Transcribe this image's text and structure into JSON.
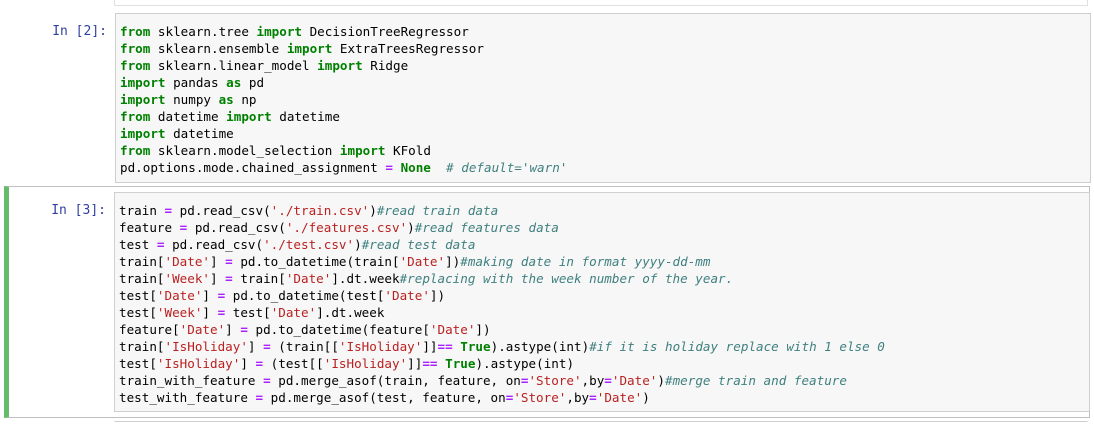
{
  "cells": [
    {
      "prompt": "In [2]:",
      "lines": [
        [
          {
            "t": "from",
            "c": "kw"
          },
          {
            "t": " sklearn.tree ",
            "c": ""
          },
          {
            "t": "import",
            "c": "kw"
          },
          {
            "t": " DecisionTreeRegressor",
            "c": ""
          }
        ],
        [
          {
            "t": "from",
            "c": "kw"
          },
          {
            "t": " sklearn.ensemble ",
            "c": ""
          },
          {
            "t": "import",
            "c": "kw"
          },
          {
            "t": " ExtraTreesRegressor",
            "c": ""
          }
        ],
        [
          {
            "t": "from",
            "c": "kw"
          },
          {
            "t": " sklearn.linear_model ",
            "c": ""
          },
          {
            "t": "import",
            "c": "kw"
          },
          {
            "t": " Ridge",
            "c": ""
          }
        ],
        [
          {
            "t": "import",
            "c": "kw"
          },
          {
            "t": " pandas ",
            "c": ""
          },
          {
            "t": "as",
            "c": "kw"
          },
          {
            "t": " pd",
            "c": ""
          }
        ],
        [
          {
            "t": "import",
            "c": "kw"
          },
          {
            "t": " numpy ",
            "c": ""
          },
          {
            "t": "as",
            "c": "kw"
          },
          {
            "t": " np",
            "c": ""
          }
        ],
        [
          {
            "t": "from",
            "c": "kw"
          },
          {
            "t": " datetime ",
            "c": ""
          },
          {
            "t": "import",
            "c": "kw"
          },
          {
            "t": " datetime",
            "c": ""
          }
        ],
        [
          {
            "t": "import",
            "c": "kw"
          },
          {
            "t": " datetime",
            "c": ""
          }
        ],
        [
          {
            "t": "from",
            "c": "kw"
          },
          {
            "t": " sklearn.model_selection ",
            "c": ""
          },
          {
            "t": "import",
            "c": "kw"
          },
          {
            "t": " KFold",
            "c": ""
          }
        ],
        [
          {
            "t": "pd.options.mode.chained_assignment ",
            "c": ""
          },
          {
            "t": "=",
            "c": "op"
          },
          {
            "t": " ",
            "c": ""
          },
          {
            "t": "None",
            "c": "kw"
          },
          {
            "t": "  # default='warn'",
            "c": "cmt"
          }
        ]
      ]
    },
    {
      "prompt": "In [3]:",
      "lines": [
        [
          {
            "t": "train ",
            "c": ""
          },
          {
            "t": "=",
            "c": "op"
          },
          {
            "t": " pd.read_csv(",
            "c": ""
          },
          {
            "t": "'./train.csv'",
            "c": "str"
          },
          {
            "t": ")",
            "c": ""
          },
          {
            "t": "#read train data",
            "c": "cmt"
          }
        ],
        [
          {
            "t": "feature ",
            "c": ""
          },
          {
            "t": "=",
            "c": "op"
          },
          {
            "t": " pd.read_csv(",
            "c": ""
          },
          {
            "t": "'./features.csv'",
            "c": "str"
          },
          {
            "t": ")",
            "c": ""
          },
          {
            "t": "#read features data",
            "c": "cmt"
          }
        ],
        [
          {
            "t": "test ",
            "c": ""
          },
          {
            "t": "=",
            "c": "op"
          },
          {
            "t": " pd.read_csv(",
            "c": ""
          },
          {
            "t": "'./test.csv'",
            "c": "str"
          },
          {
            "t": ")",
            "c": ""
          },
          {
            "t": "#read test data",
            "c": "cmt"
          }
        ],
        [
          {
            "t": "train[",
            "c": ""
          },
          {
            "t": "'Date'",
            "c": "str"
          },
          {
            "t": "] ",
            "c": ""
          },
          {
            "t": "=",
            "c": "op"
          },
          {
            "t": " pd.to_datetime(train[",
            "c": ""
          },
          {
            "t": "'Date'",
            "c": "str"
          },
          {
            "t": "])",
            "c": ""
          },
          {
            "t": "#making date in format yyyy-dd-mm",
            "c": "cmt"
          }
        ],
        [
          {
            "t": "train[",
            "c": ""
          },
          {
            "t": "'Week'",
            "c": "str"
          },
          {
            "t": "] ",
            "c": ""
          },
          {
            "t": "=",
            "c": "op"
          },
          {
            "t": " train[",
            "c": ""
          },
          {
            "t": "'Date'",
            "c": "str"
          },
          {
            "t": "].dt.week",
            "c": ""
          },
          {
            "t": "#replacing with the week number of the year.",
            "c": "cmt"
          }
        ],
        [
          {
            "t": "test[",
            "c": ""
          },
          {
            "t": "'Date'",
            "c": "str"
          },
          {
            "t": "] ",
            "c": ""
          },
          {
            "t": "=",
            "c": "op"
          },
          {
            "t": " pd.to_datetime(test[",
            "c": ""
          },
          {
            "t": "'Date'",
            "c": "str"
          },
          {
            "t": "])",
            "c": ""
          }
        ],
        [
          {
            "t": "test[",
            "c": ""
          },
          {
            "t": "'Week'",
            "c": "str"
          },
          {
            "t": "] ",
            "c": ""
          },
          {
            "t": "=",
            "c": "op"
          },
          {
            "t": " test[",
            "c": ""
          },
          {
            "t": "'Date'",
            "c": "str"
          },
          {
            "t": "].dt.week",
            "c": ""
          }
        ],
        [
          {
            "t": "feature[",
            "c": ""
          },
          {
            "t": "'Date'",
            "c": "str"
          },
          {
            "t": "] ",
            "c": ""
          },
          {
            "t": "=",
            "c": "op"
          },
          {
            "t": " pd.to_datetime(feature[",
            "c": ""
          },
          {
            "t": "'Date'",
            "c": "str"
          },
          {
            "t": "])",
            "c": ""
          }
        ],
        [
          {
            "t": "train[",
            "c": ""
          },
          {
            "t": "'IsHoliday'",
            "c": "str"
          },
          {
            "t": "] ",
            "c": ""
          },
          {
            "t": "=",
            "c": "op"
          },
          {
            "t": " (train[[",
            "c": ""
          },
          {
            "t": "'IsHoliday'",
            "c": "str"
          },
          {
            "t": "]]",
            "c": ""
          },
          {
            "t": "==",
            "c": "op"
          },
          {
            "t": " ",
            "c": ""
          },
          {
            "t": "True",
            "c": "kw"
          },
          {
            "t": ").astype(int)",
            "c": ""
          },
          {
            "t": "#if it is holiday replace with 1 else 0",
            "c": "cmt"
          }
        ],
        [
          {
            "t": "test[",
            "c": ""
          },
          {
            "t": "'IsHoliday'",
            "c": "str"
          },
          {
            "t": "] ",
            "c": ""
          },
          {
            "t": "=",
            "c": "op"
          },
          {
            "t": " (test[[",
            "c": ""
          },
          {
            "t": "'IsHoliday'",
            "c": "str"
          },
          {
            "t": "]]",
            "c": ""
          },
          {
            "t": "==",
            "c": "op"
          },
          {
            "t": " ",
            "c": ""
          },
          {
            "t": "True",
            "c": "kw"
          },
          {
            "t": ").astype(int)",
            "c": ""
          }
        ],
        [
          {
            "t": "train_with_feature ",
            "c": ""
          },
          {
            "t": "=",
            "c": "op"
          },
          {
            "t": " pd.merge_asof(train, feature, on",
            "c": ""
          },
          {
            "t": "=",
            "c": "op"
          },
          {
            "t": "'Store'",
            "c": "str"
          },
          {
            "t": ",by",
            "c": ""
          },
          {
            "t": "=",
            "c": "op"
          },
          {
            "t": "'Date'",
            "c": "str"
          },
          {
            "t": ")",
            "c": ""
          },
          {
            "t": "#merge train and feature",
            "c": "cmt"
          }
        ],
        [
          {
            "t": "test_with_feature ",
            "c": ""
          },
          {
            "t": "=",
            "c": "op"
          },
          {
            "t": " pd.merge_asof(test, feature, on",
            "c": ""
          },
          {
            "t": "=",
            "c": "op"
          },
          {
            "t": "'Store'",
            "c": "str"
          },
          {
            "t": ",by",
            "c": ""
          },
          {
            "t": "=",
            "c": "op"
          },
          {
            "t": "'Date'",
            "c": "str"
          },
          {
            "t": ")",
            "c": ""
          }
        ]
      ]
    }
  ]
}
